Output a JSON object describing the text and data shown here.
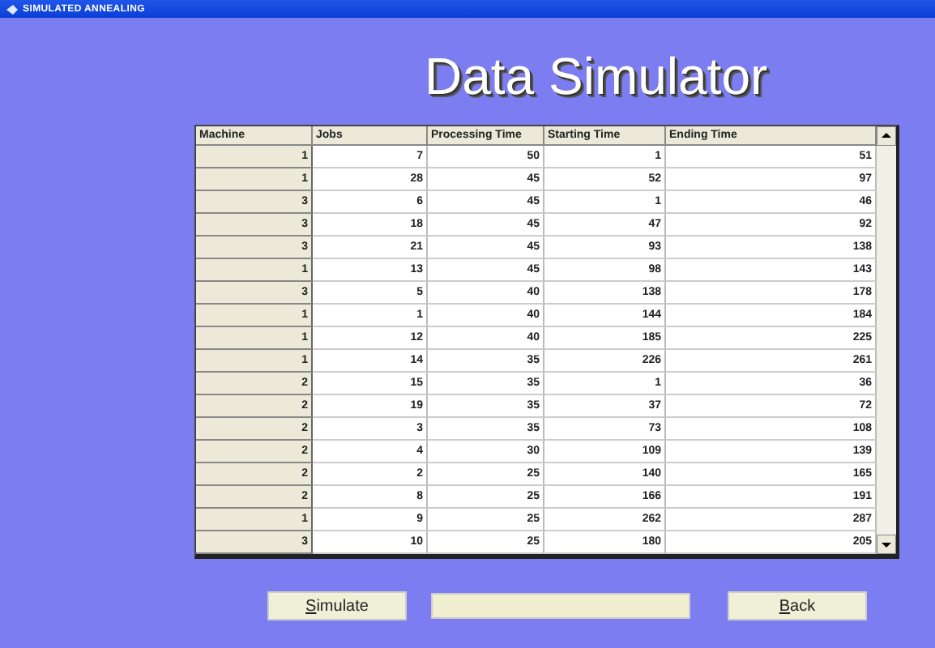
{
  "window": {
    "title": "SIMULATED ANNEALING"
  },
  "heading": "Data Simulator",
  "table": {
    "columns": [
      "Machine",
      "Jobs",
      "Processing Time",
      "Starting Time",
      "Ending Time"
    ],
    "rows": [
      [
        "1",
        "7",
        "50",
        "1",
        "51"
      ],
      [
        "1",
        "28",
        "45",
        "52",
        "97"
      ],
      [
        "3",
        "6",
        "45",
        "1",
        "46"
      ],
      [
        "3",
        "18",
        "45",
        "47",
        "92"
      ],
      [
        "3",
        "21",
        "45",
        "93",
        "138"
      ],
      [
        "1",
        "13",
        "45",
        "98",
        "143"
      ],
      [
        "3",
        "5",
        "40",
        "138",
        "178"
      ],
      [
        "1",
        "1",
        "40",
        "144",
        "184"
      ],
      [
        "1",
        "12",
        "40",
        "185",
        "225"
      ],
      [
        "1",
        "14",
        "35",
        "226",
        "261"
      ],
      [
        "2",
        "15",
        "35",
        "1",
        "36"
      ],
      [
        "2",
        "19",
        "35",
        "37",
        "72"
      ],
      [
        "2",
        "3",
        "35",
        "73",
        "108"
      ],
      [
        "2",
        "4",
        "30",
        "109",
        "139"
      ],
      [
        "2",
        "2",
        "25",
        "140",
        "165"
      ],
      [
        "2",
        "8",
        "25",
        "166",
        "191"
      ],
      [
        "1",
        "9",
        "25",
        "262",
        "287"
      ],
      [
        "3",
        "10",
        "25",
        "180",
        "205"
      ]
    ]
  },
  "buttons": [
    {
      "kind": "button",
      "label": "Simulate"
    },
    {
      "kind": "field"
    },
    {
      "kind": "button",
      "label": "Back"
    }
  ]
}
